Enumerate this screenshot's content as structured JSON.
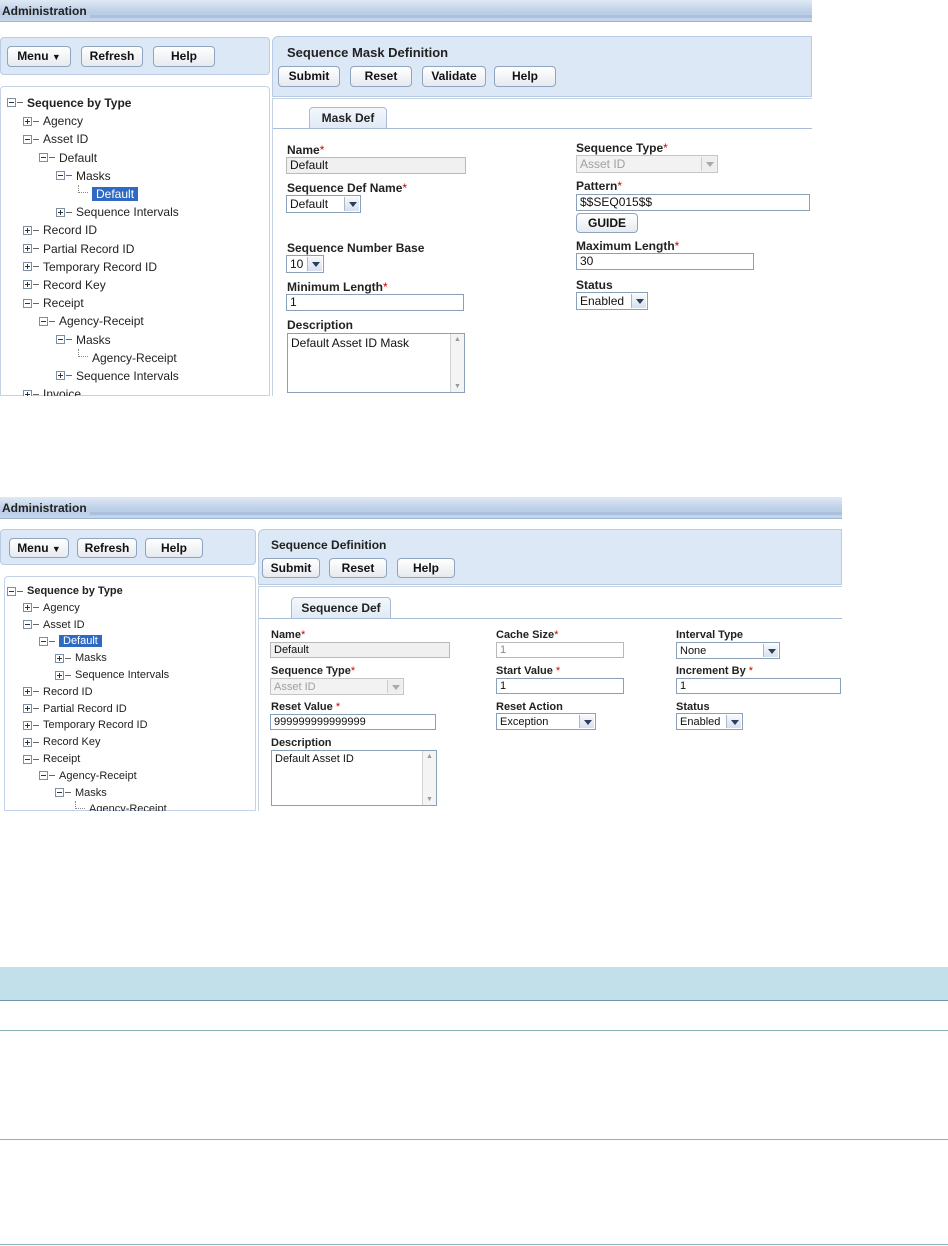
{
  "panel1": {
    "admin_title": "Administration",
    "left_buttons": [
      "Menu",
      "Refresh",
      "Help"
    ],
    "tree": [
      {
        "label": "Sequence by Type",
        "toggle": "minus",
        "bold": true
      },
      {
        "label": "Agency",
        "toggle": "plus"
      },
      {
        "label": "Asset ID",
        "toggle": "minus"
      },
      {
        "label": "Default",
        "toggle": "minus"
      },
      {
        "label": "Masks",
        "toggle": "minus"
      },
      {
        "label": "Default",
        "toggle": "leaf",
        "selected": true
      },
      {
        "label": "Sequence Intervals",
        "toggle": "plus"
      },
      {
        "label": "Record ID",
        "toggle": "plus"
      },
      {
        "label": "Partial Record ID",
        "toggle": "plus"
      },
      {
        "label": "Temporary Record ID",
        "toggle": "plus"
      },
      {
        "label": "Record Key",
        "toggle": "plus"
      },
      {
        "label": "Receipt",
        "toggle": "minus"
      },
      {
        "label": "Agency-Receipt",
        "toggle": "minus"
      },
      {
        "label": "Masks",
        "toggle": "minus"
      },
      {
        "label": "Agency-Receipt",
        "toggle": "leaf"
      },
      {
        "label": "Sequence Intervals",
        "toggle": "plus"
      },
      {
        "label": "Invoice",
        "toggle": "plus"
      }
    ],
    "form_title": "Sequence Mask Definition",
    "form_buttons": [
      "Submit",
      "Reset",
      "Validate",
      "Help"
    ],
    "tab": "Mask Def",
    "fields": {
      "name_label": "Name",
      "name_value": "Default",
      "seq_def_name_label": "Sequence Def Name",
      "seq_def_name_value": "Default",
      "seq_number_base_label": "Sequence Number Base",
      "seq_number_base_value": "10",
      "min_length_label": "Minimum Length",
      "min_length_value": "1",
      "description_label": "Description",
      "description_value": "Default Asset ID Mask",
      "seq_type_label": "Sequence Type",
      "seq_type_value": "Asset ID",
      "pattern_label": "Pattern",
      "pattern_value": "$$SEQ015$$",
      "guide_button": "GUIDE",
      "max_length_label": "Maximum Length",
      "max_length_value": "30",
      "status_label": "Status",
      "status_value": "Enabled"
    }
  },
  "panel2": {
    "admin_title": "Administration",
    "left_buttons": [
      "Menu",
      "Refresh",
      "Help"
    ],
    "tree": [
      {
        "label": "Sequence by Type",
        "toggle": "minus",
        "bold": true
      },
      {
        "label": "Agency",
        "toggle": "plus"
      },
      {
        "label": "Asset ID",
        "toggle": "minus"
      },
      {
        "label": "Default",
        "toggle": "minus",
        "selected": true
      },
      {
        "label": "Masks",
        "toggle": "plus"
      },
      {
        "label": "Sequence Intervals",
        "toggle": "plus"
      },
      {
        "label": "Record ID",
        "toggle": "plus"
      },
      {
        "label": "Partial Record ID",
        "toggle": "plus"
      },
      {
        "label": "Temporary Record ID",
        "toggle": "plus"
      },
      {
        "label": "Record Key",
        "toggle": "plus"
      },
      {
        "label": "Receipt",
        "toggle": "minus"
      },
      {
        "label": "Agency-Receipt",
        "toggle": "minus"
      },
      {
        "label": "Masks",
        "toggle": "minus"
      },
      {
        "label": "Agency-Receipt",
        "toggle": "leaf"
      }
    ],
    "form_title": "Sequence Definition",
    "form_buttons": [
      "Submit",
      "Reset",
      "Help"
    ],
    "tab": "Sequence Def",
    "fields": {
      "name_label": "Name",
      "name_value": "Default",
      "seq_type_label": "Sequence Type",
      "seq_type_value": "Asset ID",
      "reset_value_label": "Reset Value",
      "reset_value_value": "999999999999999",
      "description_label": "Description",
      "description_value": "Default Asset ID",
      "cache_size_label": "Cache Size",
      "cache_size_value": "1",
      "start_value_label": "Start Value",
      "start_value_value": "1",
      "reset_action_label": "Reset Action",
      "reset_action_value": "Exception",
      "interval_type_label": "Interval Type",
      "interval_type_value": "None",
      "increment_by_label": "Increment By",
      "increment_by_value": "1",
      "status_label": "Status",
      "status_value": "Enabled"
    }
  },
  "required_marker": "*",
  "colors": {
    "selection": "#2f69c2",
    "header_bar": "#b9cde6",
    "required": "#cc0000",
    "table_header": "#c2e0ea"
  }
}
